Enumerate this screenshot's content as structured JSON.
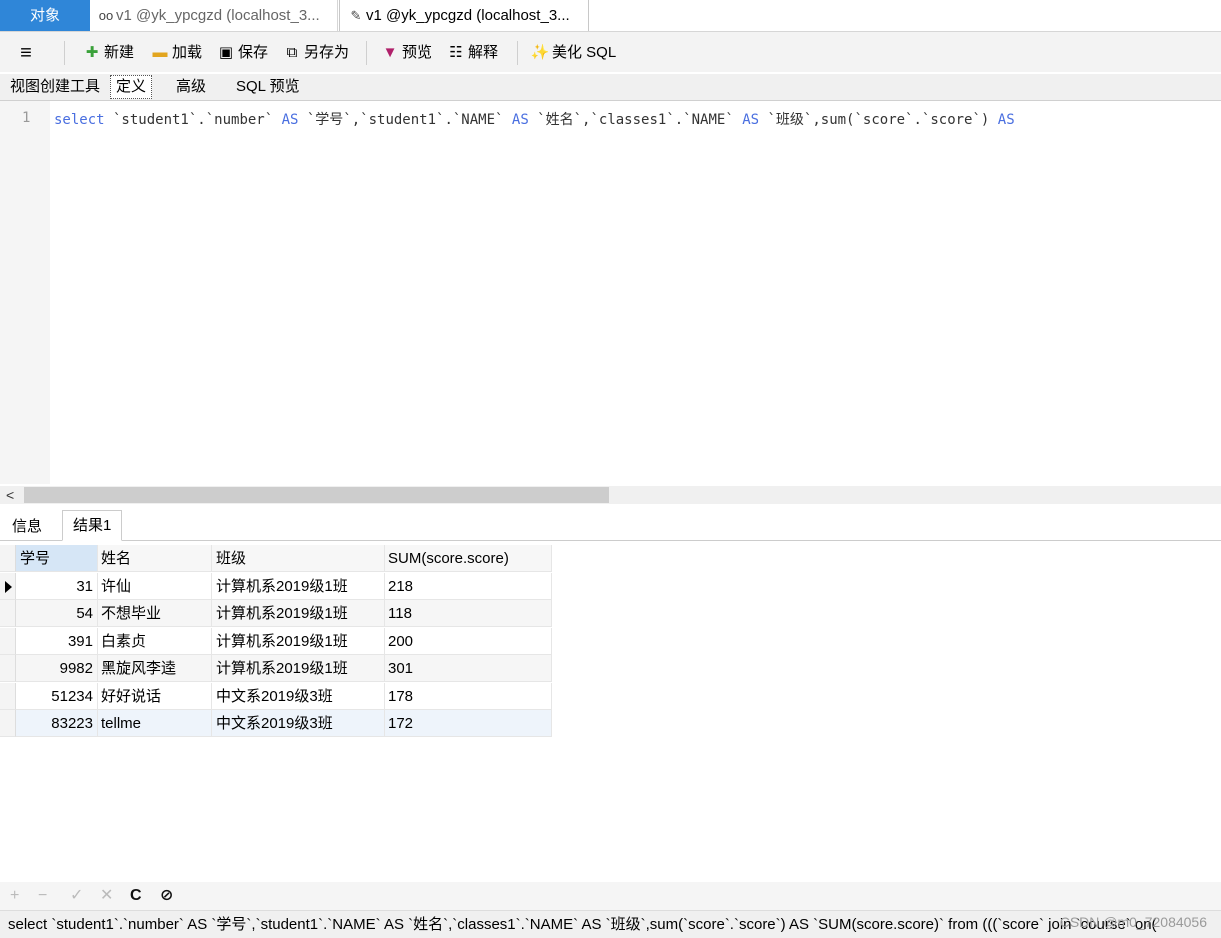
{
  "window_tabs": {
    "objects": "对象",
    "tab1": "v1 @yk_ypcgzd (localhost_3...",
    "tab2": "v1 @yk_ypcgzd (localhost_3..."
  },
  "toolbar": {
    "new": "新建",
    "load": "加载",
    "save": "保存",
    "save_as": "另存为",
    "preview": "预览",
    "explain": "解释",
    "beautify": "美化 SQL"
  },
  "subtabs": [
    "视图创建工具",
    "定义",
    "高级",
    "SQL 预览"
  ],
  "editor": {
    "line_number": "1",
    "tokens": [
      {
        "t": "select",
        "kw": true
      },
      {
        "t": " `student1`.`number` ",
        "kw": false
      },
      {
        "t": "AS",
        "kw": true
      },
      {
        "t": " `学号`,`student1`.`NAME` ",
        "kw": false
      },
      {
        "t": "AS",
        "kw": true
      },
      {
        "t": " `姓名`,`classes1`.`NAME` ",
        "kw": false
      },
      {
        "t": "AS",
        "kw": true
      },
      {
        "t": " `班级`,sum(`score`.`score`) ",
        "kw": false
      },
      {
        "t": "AS",
        "kw": true
      }
    ]
  },
  "result_tabs": [
    "信息",
    "结果1"
  ],
  "grid": {
    "columns": [
      "学号",
      "姓名",
      "班级",
      "SUM(score.score)"
    ],
    "rows": [
      [
        "31",
        "许仙",
        "计算机系2019级1班",
        "218"
      ],
      [
        "54",
        "不想毕业",
        "计算机系2019级1班",
        "118"
      ],
      [
        "391",
        "白素贞",
        "计算机系2019级1班",
        "200"
      ],
      [
        "9982",
        "黑旋风李逵",
        "计算机系2019级1班",
        "301"
      ],
      [
        "51234",
        "好好说话",
        "中文系2019级3班",
        "178"
      ],
      [
        "83223",
        "tellme",
        "中文系2019级3班",
        "172"
      ]
    ]
  },
  "bottom_bar": {
    "add": "+",
    "remove": "−",
    "apply": "✓",
    "discard": "✕",
    "refresh": "C",
    "stop": "⊘"
  },
  "status": {
    "sql": "select `student1`.`number` AS `学号`,`student1`.`NAME` AS `姓名`,`classes1`.`NAME` AS `班级`,sum(`score`.`score`) AS `SUM(score.score)` from (((`score` join `course` on(",
    "watermark": "CSDN @m0_72084056"
  }
}
